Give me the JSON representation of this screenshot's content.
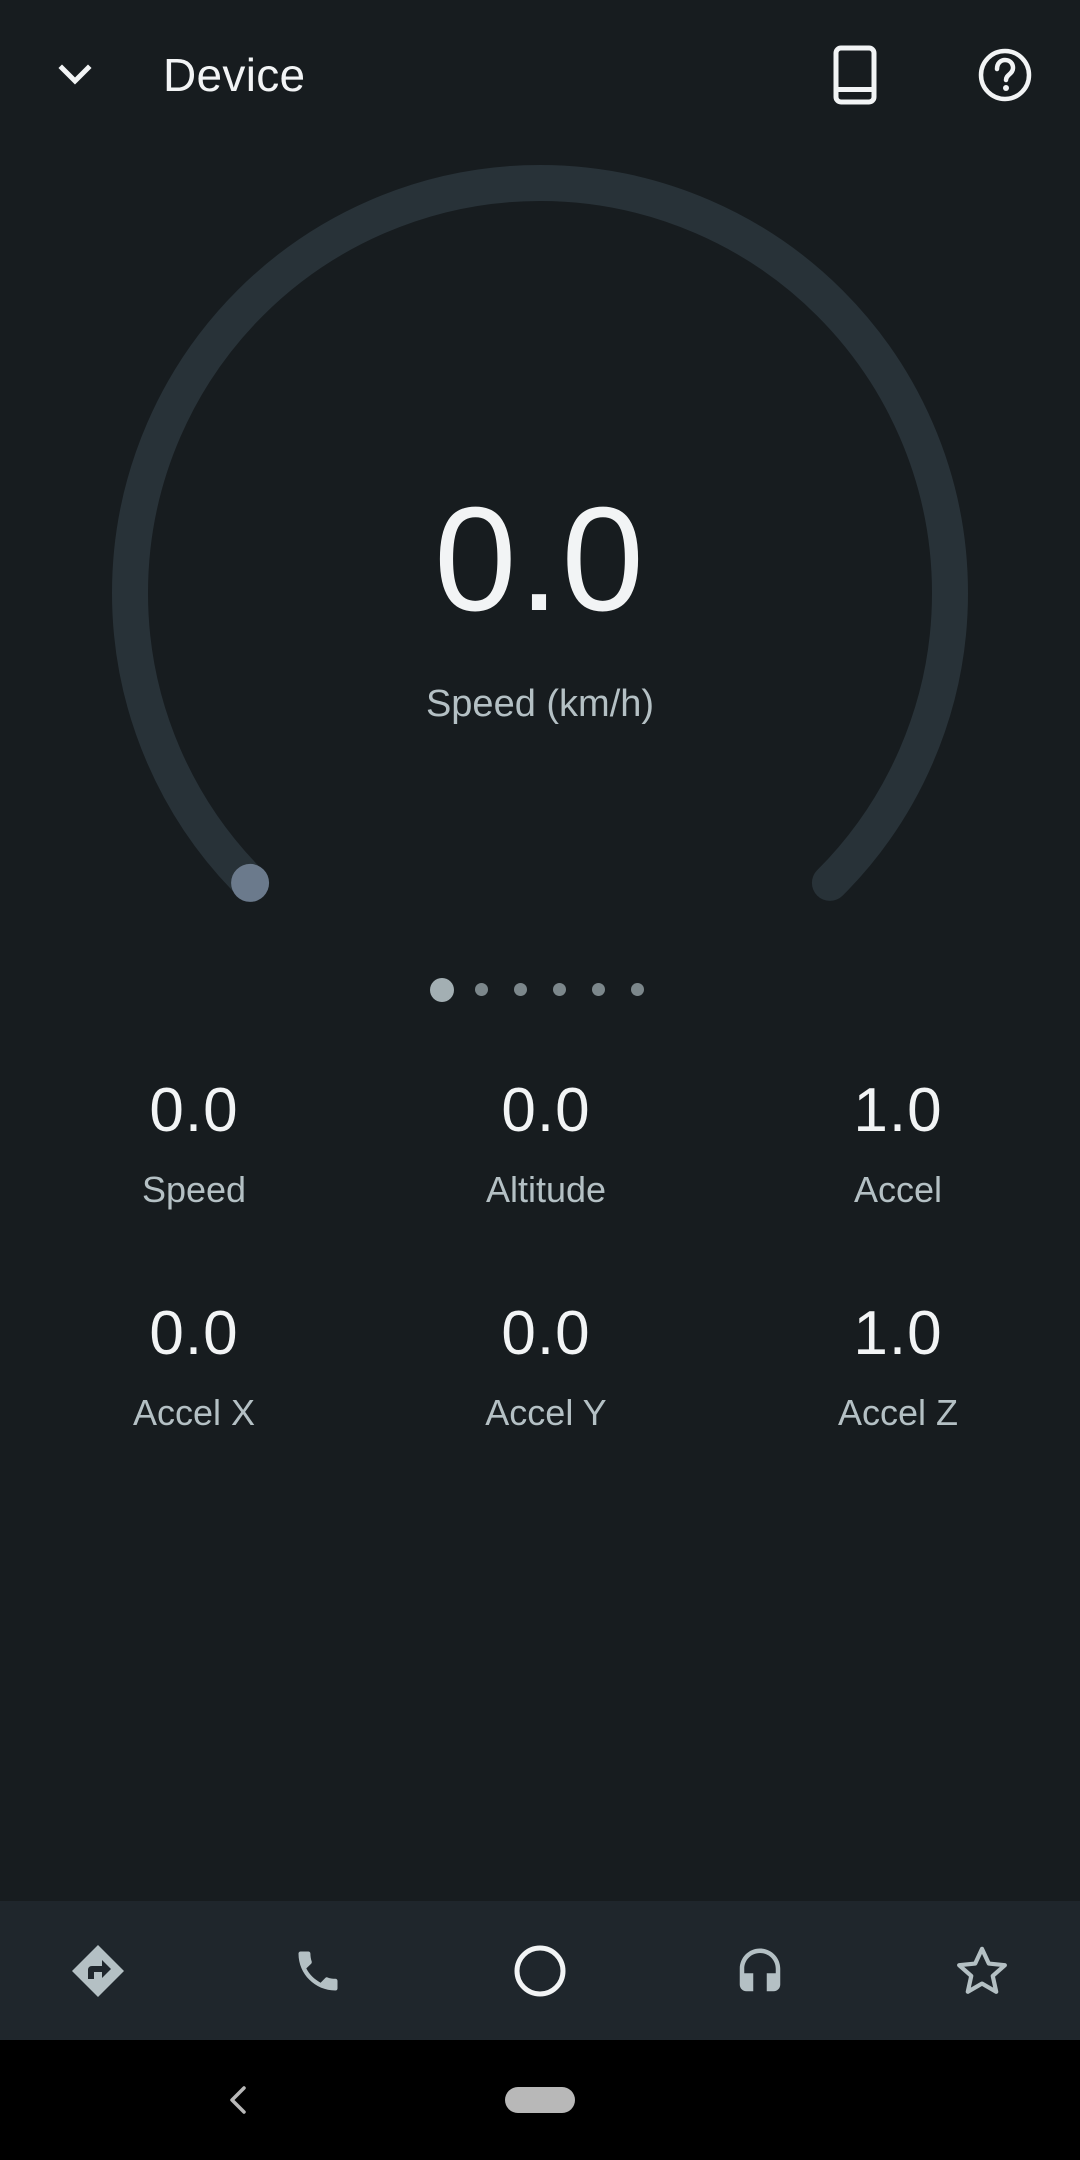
{
  "header": {
    "title": "Device",
    "icons": {
      "collapse": "chevron-down-icon",
      "device": "phone-icon",
      "help": "help-circle-icon"
    }
  },
  "gauge": {
    "value": "0.0",
    "label": "Speed (km/h)",
    "fraction": 0.0,
    "track_color": "#283238",
    "indicator_color": "#6b7a8c"
  },
  "pager": {
    "count": 6,
    "active_index": 0
  },
  "stats": [
    {
      "value": "0.0",
      "label": "Speed"
    },
    {
      "value": "0.0",
      "label": "Altitude"
    },
    {
      "value": "1.0",
      "label": "Accel"
    },
    {
      "value": "0.0",
      "label": "Accel X"
    },
    {
      "value": "0.0",
      "label": "Accel Y"
    },
    {
      "value": "1.0",
      "label": "Accel Z"
    }
  ],
  "bottom_nav": {
    "items": [
      {
        "name": "navigation",
        "icon": "directions-icon"
      },
      {
        "name": "phone",
        "icon": "phone-call-icon"
      },
      {
        "name": "home",
        "icon": "circle-home-icon"
      },
      {
        "name": "media",
        "icon": "headphones-icon"
      },
      {
        "name": "favorites",
        "icon": "star-icon"
      }
    ]
  },
  "colors": {
    "background": "#171c1f",
    "bottom_nav_background": "#1f262c",
    "text_primary": "#f2f4f5",
    "text_secondary": "#b4c0c4"
  }
}
